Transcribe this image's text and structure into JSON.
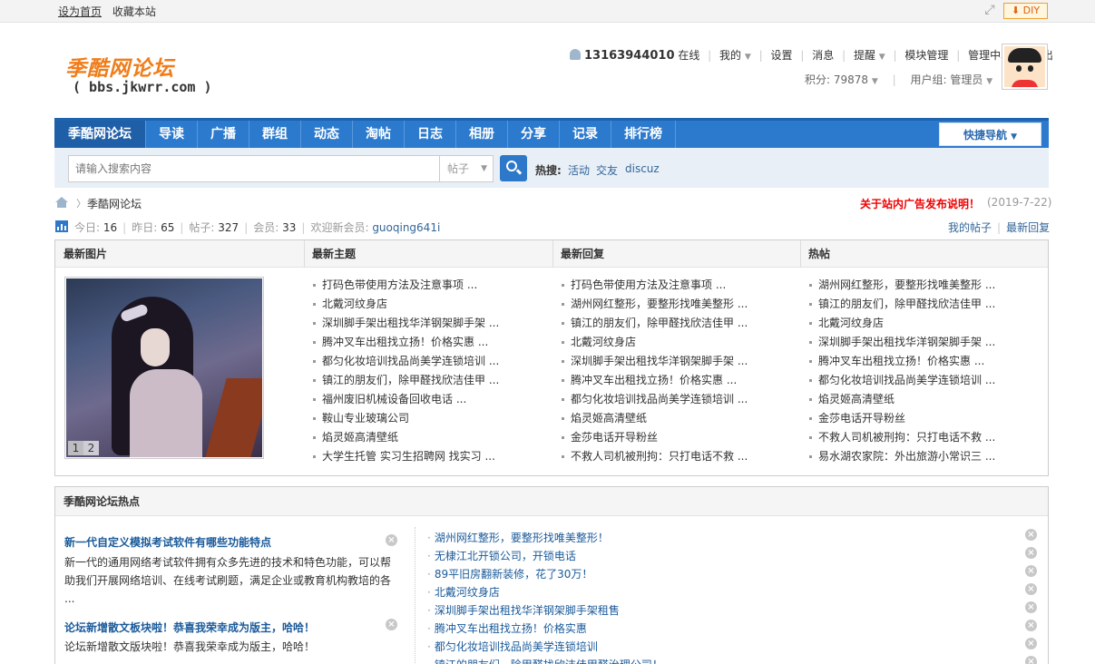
{
  "topbar": {
    "set_home": "设为首页",
    "bookmark": "收藏本站",
    "diy": "DIY",
    "diy_icon": "down-arrow-icon"
  },
  "header": {
    "logo_title": "季酷网论坛",
    "logo_domain": "( bbs.jkwrr.com )",
    "user": {
      "uid": "13163944010",
      "online": "在线",
      "my": "我的",
      "settings": "设置",
      "messages": "消息",
      "remind": "提醒",
      "module_manage": "模块管理",
      "admin_center": "管理中心",
      "logout": "退出"
    },
    "points_label": "积分: 79878",
    "group_label": "用户组: 管理员"
  },
  "nav": {
    "items": [
      "季酷网论坛",
      "导读",
      "广播",
      "群组",
      "动态",
      "淘帖",
      "日志",
      "相册",
      "分享",
      "记录",
      "排行榜"
    ],
    "quick_nav": "快捷导航"
  },
  "search": {
    "placeholder": "请输入搜索内容",
    "type": "帖子",
    "hot_label": "热搜:",
    "hot_keywords": [
      "活动",
      "交友",
      "discuz"
    ]
  },
  "breadcrumb": {
    "current": "季酷网论坛",
    "notice": "关于站内广告发布说明！",
    "notice_date": "(2019-7-22)"
  },
  "forum_stats": {
    "today_label": "今日:",
    "today": "16",
    "yesterday_label": "昨日:",
    "yesterday": "65",
    "posts_label": "帖子:",
    "posts": "327",
    "members_label": "会员:",
    "members": "33",
    "welcome_label": "欢迎新会员:",
    "newest_member": "guoqing641i",
    "my_posts": "我的帖子",
    "latest_replies": "最新回复"
  },
  "latest_panel": {
    "heads": [
      "最新图片",
      "最新主题",
      "最新回复",
      "热帖"
    ],
    "pager": [
      "1",
      "2"
    ],
    "new_threads": [
      "打码色带使用方法及注意事项 ...",
      "北戴河纹身店",
      "深圳脚手架出租找华洋钢架脚手架 ...",
      "腾冲叉车出租找立扬！价格实惠 ...",
      "都匀化妆培训找品尚美学连锁培训 ...",
      "镇江的朋友们，除甲醛找欣洁佳甲 ...",
      "福州废旧机械设备回收电话 ...",
      "鞍山专业玻璃公司",
      "焰灵姬高清壁纸",
      "大学生托管 实习生招聘网 找实习 ..."
    ],
    "new_replies": [
      "打码色带使用方法及注意事项 ...",
      "湖州网红整形，要整形找唯美整形 ...",
      "镇江的朋友们，除甲醛找欣洁佳甲 ...",
      "北戴河纹身店",
      "深圳脚手架出租找华洋钢架脚手架 ...",
      "腾冲叉车出租找立扬！价格实惠 ...",
      "都匀化妆培训找品尚美学连锁培训 ...",
      "焰灵姬高清壁纸",
      "金莎电话开导粉丝",
      "不救人司机被刑拘：只打电话不救 ..."
    ],
    "hot_threads": [
      "湖州网红整形，要整形找唯美整形 ...",
      "镇江的朋友们，除甲醛找欣洁佳甲 ...",
      "北戴河纹身店",
      "深圳脚手架出租找华洋钢架脚手架 ...",
      "腾冲叉车出租找立扬！价格实惠 ...",
      "都匀化妆培训找品尚美学连锁培训 ...",
      "焰灵姬高清壁纸",
      "金莎电话开导粉丝",
      "不救人司机被刑拘：只打电话不救 ...",
      "易水湖农家院：外出旅游小常识三 ..."
    ]
  },
  "hot_panel": {
    "title": "季酷网论坛热点",
    "featured": [
      {
        "title": "新一代自定义模拟考试软件有哪些功能特点",
        "desc": "新一代的通用网络考试软件拥有众多先进的技术和特色功能，可以帮助我们开展网络培训、在线考试刷题，满足企业或教育机构教培的各 ..."
      },
      {
        "title": "论坛新增散文板块啦！恭喜我荣幸成为版主，哈哈！",
        "desc": "论坛新增散文版块啦！恭喜我荣幸成为版主，哈哈！"
      }
    ],
    "links": [
      "湖州网红整形，要整形找唯美整形！",
      "无棣江北开锁公司，开锁电话",
      "89平旧房翻新装修，花了30万！",
      "北戴河纹身店",
      "深圳脚手架出租找华洋钢架脚手架租售",
      "腾冲叉车出租找立扬！价格实惠",
      "都匀化妆培训找品尚美学连锁培训",
      "镇江的朋友们，除甲醛找欣洁佳甲醛治理公司！"
    ]
  }
}
